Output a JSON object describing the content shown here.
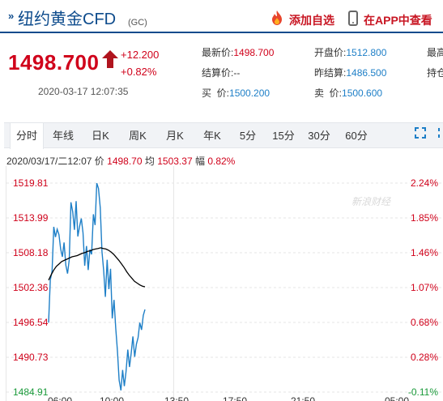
{
  "header": {
    "title_prefix": "»",
    "title": "纽约黄金CFD",
    "code": "(GC)",
    "add_favorite_label": "添加自选",
    "app_view_label": "在APP中查看"
  },
  "quote": {
    "price": "1498.700",
    "change": "+12.200",
    "change_percent": "+0.82%",
    "datetime": "2020-03-17 12:07:35",
    "fields": [
      {
        "label": "最新价:",
        "value": "1498.700",
        "color": "red"
      },
      {
        "label": "开盘价:",
        "value": "1512.800",
        "color": "blue"
      },
      {
        "label": "最高",
        "value": "",
        "color": "gray"
      },
      {
        "label": "结算价:",
        "value": "--",
        "color": "gray"
      },
      {
        "label": "昨结算:",
        "value": "1486.500",
        "color": "blue"
      },
      {
        "label": "持仓",
        "value": "",
        "color": "gray"
      },
      {
        "label": "买  价:",
        "value": "1500.200",
        "color": "blue"
      },
      {
        "label": "卖  价:",
        "value": "1500.600",
        "color": "blue"
      },
      {
        "label": "",
        "value": "",
        "color": "gray"
      }
    ]
  },
  "tabs": [
    {
      "label": "分时",
      "active": true
    },
    {
      "label": "年线",
      "active": false
    },
    {
      "label": "日K",
      "active": false
    },
    {
      "label": "周K",
      "active": false
    },
    {
      "label": "月K",
      "active": false
    },
    {
      "label": "年K",
      "active": false
    },
    {
      "label": "5分",
      "active": false
    },
    {
      "label": "15分",
      "active": false
    },
    {
      "label": "30分",
      "active": false
    },
    {
      "label": "60分",
      "active": false
    }
  ],
  "info_line": {
    "datetime": "2020/03/17/二12:07",
    "price_label": "价",
    "price": "1498.70",
    "avg_label": "均",
    "avg": "1503.37",
    "pct_label": "幅",
    "pct": "0.82%"
  },
  "watermark": "新浪财经",
  "chart_data": {
    "type": "line",
    "y_ticks": [
      "1519.81",
      "1513.99",
      "1508.18",
      "1502.36",
      "1496.54",
      "1490.73",
      "1484.91"
    ],
    "pct_ticks": [
      "2.24%",
      "1.85%",
      "1.46%",
      "1.07%",
      "0.68%",
      "0.28%",
      "-0.11%"
    ],
    "x_ticks": [
      "06:00",
      "10:00",
      "13:50",
      "17:50",
      "21:50",
      "05:00"
    ],
    "ylim": [
      1484.91,
      1519.81
    ],
    "colors": {
      "price": "#1e7fc7",
      "average": "#000000",
      "grid": "#e6e6e6",
      "up_axis": "#d0021b",
      "down_axis": "#1a9a3a"
    },
    "series": [
      {
        "name": "价",
        "values": [
          1496.5,
          1503.6,
          1505.1,
          1512.5,
          1510.8,
          1512.1,
          1511.2,
          1508.8,
          1507.5,
          1509.9,
          1506.1,
          1504.7,
          1507.0,
          1516.6,
          1515.0,
          1512.0,
          1516.8,
          1510.9,
          1512.6,
          1513.9,
          1511.5,
          1506.0,
          1509.3,
          1505.3,
          1508.7,
          1507.9,
          1514.6,
          1512.8,
          1519.8,
          1518.9,
          1515.7,
          1508.4,
          1505.2,
          1500.8,
          1507.0,
          1502.1,
          1505.5,
          1497.2,
          1500.3,
          1495.6,
          1491.8,
          1486.9,
          1485.2,
          1488.6,
          1485.9,
          1488.3,
          1492.0,
          1489.1,
          1491.4,
          1494.2,
          1490.8,
          1492.9,
          1494.0,
          1496.5,
          1495.3,
          1497.7,
          1498.7
        ]
      },
      {
        "name": "均",
        "values": [
          1503.6,
          1504.5,
          1505.3,
          1505.9,
          1506.3,
          1506.7,
          1506.9,
          1507.1,
          1507.3,
          1507.5,
          1507.6,
          1507.7,
          1507.9,
          1508.1,
          1508.2,
          1508.4,
          1508.5,
          1508.7,
          1508.8,
          1508.9,
          1509.0,
          1508.9,
          1508.8,
          1508.6,
          1508.3,
          1507.9,
          1507.4,
          1506.9,
          1506.3,
          1505.7,
          1505.0,
          1504.4,
          1503.9,
          1503.4,
          1503.1,
          1502.8,
          1502.6,
          1502.5
        ]
      }
    ]
  }
}
